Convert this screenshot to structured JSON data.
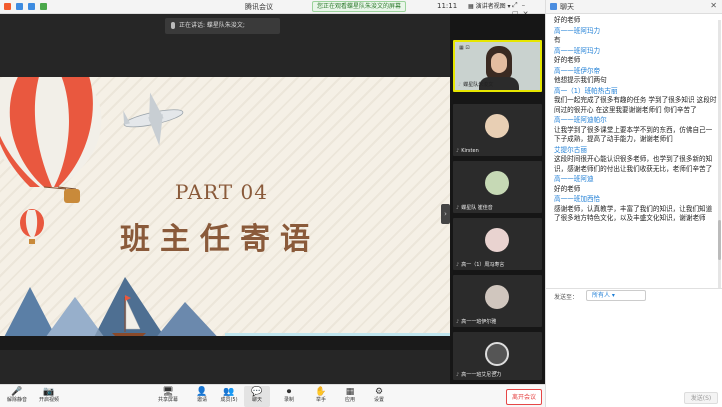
{
  "titlebar": {
    "app_title": "腾讯会议",
    "share_banner": "您正在观看蝶星队朱浚文的屏幕",
    "clock": "11:11",
    "view_label": "演讲者视图"
  },
  "main": {
    "speaking": "正在讲话: 蝶星队朱浚文;"
  },
  "slide": {
    "part": "PART 04",
    "title": "班主任寄语"
  },
  "participants": [
    {
      "name": "蝶星队朱浚文",
      "active": true
    },
    {
      "name": "Kirsten"
    },
    {
      "name": "蝶星队 崔佳音"
    },
    {
      "name": "高一（1）周冯寿言"
    },
    {
      "name": "高一一班伊尔雅"
    },
    {
      "name": "高一一班艾尼吾力"
    }
  ],
  "chat": {
    "title": "聊天",
    "messages": [
      {
        "sender": "",
        "text": "好的老师"
      },
      {
        "sender": "高一一班阿玛力",
        "text": "有"
      },
      {
        "sender": "高一一班阿玛力",
        "text": "好的老师"
      },
      {
        "sender": "高一一班伊尔帝",
        "text": "他想提示我们两句"
      },
      {
        "sender": "高一（1）班帕热古丽",
        "text": "我们一起完成了很多有趣的任务 学到了很多知识 这段时间过的很开心 在这里我要谢谢老师们 你们辛苦了"
      },
      {
        "sender": "高一一班阿迪帕尔",
        "text": "让我学到了很多课堂上要本学不到的东西，仿佛自己一下子成熟，提高了动手能力，谢谢老师们"
      },
      {
        "sender": "艾提尔古丽",
        "text": "这段时间很开心能认识很多老师，也学到了很多新的知识，感谢老师们的付出让我们收获无比，老师们辛苦了"
      },
      {
        "sender": "高一一班阿迪",
        "text": "好的老师"
      },
      {
        "sender": "高一一班加西恰",
        "text": "感谢老师，认真教学，丰富了我们的知识，让我们知道了很多地方特色文化，以及丰盛文化知识，谢谢老师"
      }
    ],
    "send_label": "发送至：",
    "send_target": "所有人",
    "send_button": "发送(S)"
  },
  "toolbar": {
    "buttons": [
      {
        "icon": "🎤",
        "label": "解除静音"
      },
      {
        "icon": "📷",
        "label": "开启视频"
      },
      {
        "icon": "🖥",
        "label": "共享屏幕"
      },
      {
        "icon": "👤",
        "label": "邀请"
      },
      {
        "icon": "👥",
        "label": "成员(5)"
      },
      {
        "icon": "💬",
        "label": "聊天"
      },
      {
        "icon": "⏺",
        "label": "录制"
      },
      {
        "icon": "✋",
        "label": "举手"
      },
      {
        "icon": "▦",
        "label": "应用"
      },
      {
        "icon": "⚙",
        "label": "设置"
      }
    ],
    "leave": "离开会议"
  }
}
